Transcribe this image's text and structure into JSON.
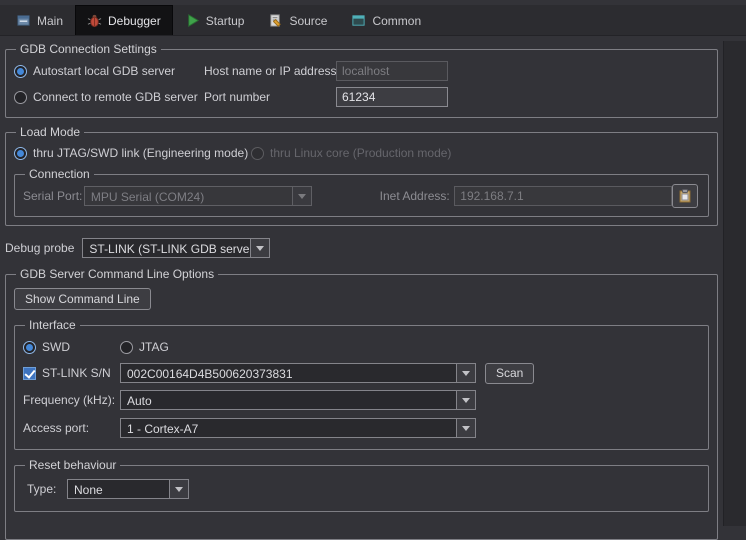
{
  "colors": {
    "accent_blue": "#4488d8",
    "selected_tab_bg": "#121214"
  },
  "tabs": [
    {
      "label": "Main",
      "icon": "main-icon",
      "selected": false
    },
    {
      "label": "Debugger",
      "icon": "bug-icon",
      "selected": true
    },
    {
      "label": "Startup",
      "icon": "startup-icon",
      "selected": false
    },
    {
      "label": "Source",
      "icon": "source-icon",
      "selected": false
    },
    {
      "label": "Common",
      "icon": "common-icon",
      "selected": false
    }
  ],
  "gdb_connection": {
    "title": "GDB Connection Settings",
    "autostart_radio": "Autostart local GDB server",
    "remote_radio": "Connect to remote GDB server",
    "host_label": "Host name or IP address",
    "host_value": "localhost",
    "port_label": "Port number",
    "port_value": "61234"
  },
  "load_mode": {
    "title": "Load Mode",
    "jtag_radio": "thru JTAG/SWD link (Engineering mode)",
    "linux_radio": "thru Linux core (Production mode)",
    "connection": {
      "title": "Connection",
      "serial_port_label": "Serial Port:",
      "serial_port_value": "MPU Serial (COM24)",
      "inet_label": "Inet Address:",
      "inet_value": "192.168.7.1"
    }
  },
  "debug_probe": {
    "label": "Debug probe",
    "value": "ST-LINK (ST-LINK GDB server)"
  },
  "gdb_server_options": {
    "title": "GDB Server Command Line Options",
    "show_command_line": "Show Command Line",
    "interface": {
      "title": "Interface",
      "swd_radio": "SWD",
      "jtag_radio": "JTAG",
      "stlink_sn_label": "ST-LINK S/N",
      "stlink_sn_value": "002C00164D4B500620373831",
      "scan_button": "Scan",
      "frequency_label": "Frequency (kHz):",
      "frequency_value": "Auto",
      "access_port_label": "Access port:",
      "access_port_value": "1 - Cortex-A7"
    },
    "reset": {
      "title": "Reset behaviour",
      "type_label": "Type:",
      "type_value": "None"
    }
  }
}
